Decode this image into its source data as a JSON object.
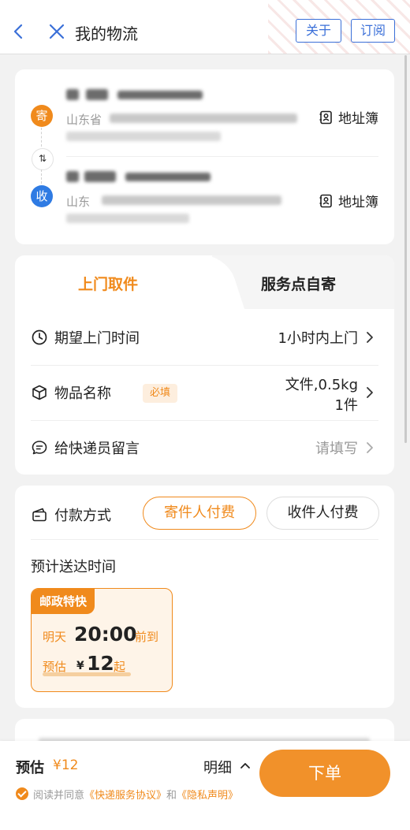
{
  "header": {
    "title": "我的物流",
    "about_label": "关于",
    "subscribe_label": "订阅"
  },
  "address": {
    "sender_badge": "寄",
    "receiver_badge": "收",
    "sender_province": "山东省",
    "receiver_province": "山东",
    "address_book_label": "地址簿",
    "swap_icon_text": "⇅"
  },
  "pickup": {
    "tab_pickup": "上门取件",
    "tab_self_drop": "服务点自寄",
    "time_label": "期望上门时间",
    "time_value": "1小时内上门",
    "item_label": "物品名称",
    "required_tag": "必填",
    "item_value_line1": "文件,0.5kg",
    "item_value_line2": "1件",
    "message_label": "给快递员留言",
    "message_placeholder": "请填写"
  },
  "payment": {
    "label": "付款方式",
    "option_sender": "寄件人付费",
    "option_receiver": "收件人付费",
    "selected": "寄件人付费",
    "eta_title": "预计送达时间",
    "service": {
      "name": "邮政特快",
      "when": "明天",
      "time": "20:00",
      "arrive": "前到",
      "est_label": "预估",
      "currency": "¥",
      "price": "12",
      "from": "起"
    }
  },
  "bottom_bar": {
    "est_label": "预估",
    "est_price": "¥12",
    "detail_label": "明细",
    "order_label": "下单",
    "agree_prefix": "阅读并同意",
    "agreement_1": "《快递服务协议》",
    "agree_and": "和",
    "agreement_2": "《隐私声明》"
  },
  "colors": {
    "accent": "#f08a1c",
    "link_blue": "#3a6fd8",
    "receiver_blue": "#2f7be3"
  }
}
